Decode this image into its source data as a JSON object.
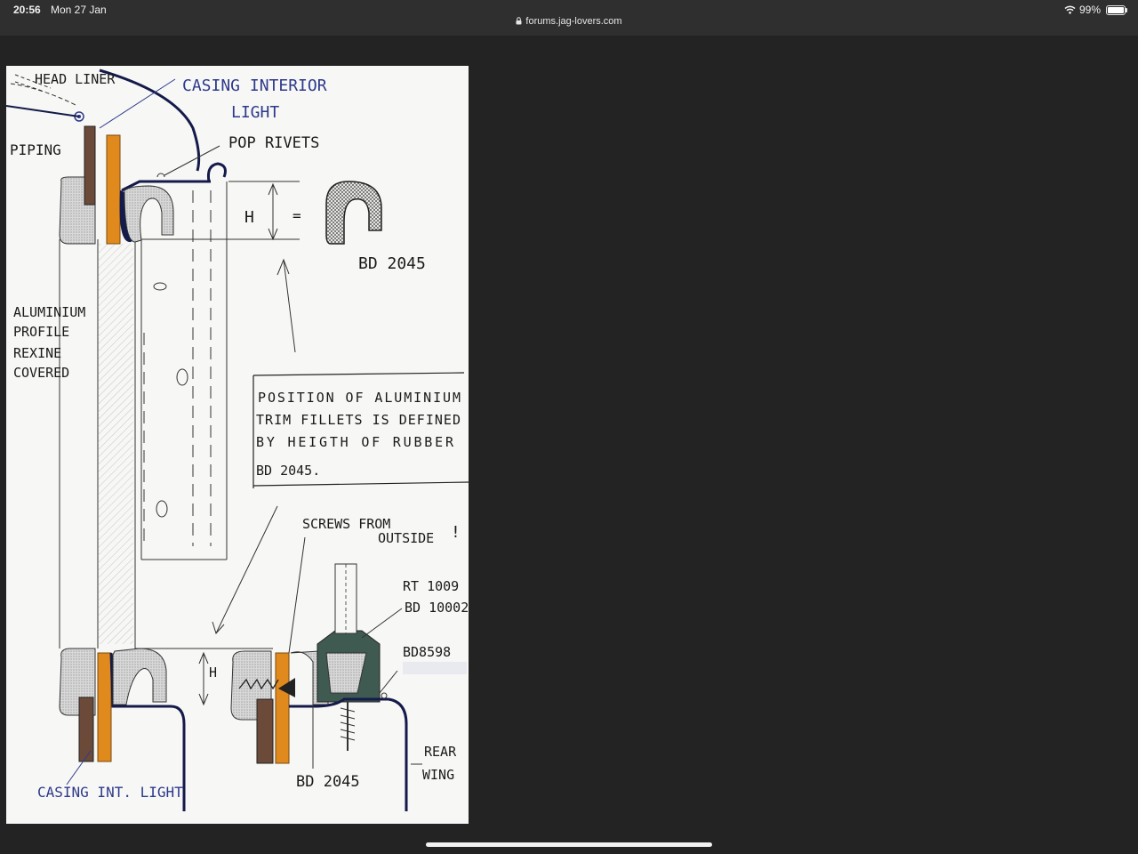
{
  "status_bar": {
    "time": "20:56",
    "date": "Mon 27 Jan",
    "url": "forums.jag-lovers.com",
    "battery_text": "99%",
    "battery_level": 0.99
  },
  "sketch": {
    "labels": {
      "head_liner": "HEAD LINER",
      "casing_interior_light_1": "CASING INTERIOR",
      "casing_interior_light_2": "LIGHT",
      "piping": "PIPING",
      "pop_rivets": "POP RIVETS",
      "h_top": "H",
      "equals": "=",
      "bd2045_top": "BD 2045",
      "aluminium_1": "ALUMINIUM",
      "aluminium_2": "PROFILE",
      "aluminium_3": "REXINE",
      "aluminium_4": "COVERED",
      "note_1": "POSITION OF ALUMINIUM",
      "note_2": "TRIM FILLETS IS DEFINED",
      "note_3": "BY HEIGTH OF RUBBER",
      "note_4": "BD 2045.",
      "screws_1": "SCREWS FROM",
      "screws_2": "OUTSIDE",
      "screws_excl": "!",
      "rt1009": "RT 1009",
      "bd10002": "BD 10002",
      "bd8598": "BD8598",
      "h_bottom": "H",
      "rear_1": "REAR",
      "rear_2": "WING",
      "bd2045_bottom": "BD 2045",
      "casing_int_light": "CASING INT. LIGHT"
    },
    "colors": {
      "ink_black": "#1a1a1a",
      "ink_blue": "#2e3a8c",
      "ink_navy": "#141a4a",
      "rubber_grey": "#8c8c8c",
      "orange": "#e08a1e",
      "brown": "#6b4a3a",
      "green": "#3f5a50"
    }
  }
}
